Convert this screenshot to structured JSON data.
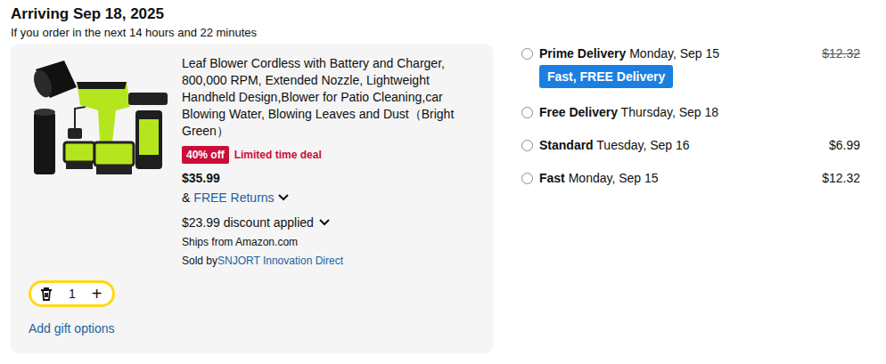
{
  "header": {
    "title": "Arriving Sep 18, 2025",
    "subtitle": "If you order in the next 14 hours and 22 minutes"
  },
  "item": {
    "title": "Leaf Blower Cordless with Battery and Charger, 800,000 RPM, Extended Nozzle, Lightweight Handheld Design,Blower for Patio Cleaning,car Blowing Water, Blowing Leaves and Dust（Bright Green）",
    "badge": "40% off",
    "deal": "Limited time deal",
    "price": "$35.99",
    "returns_prefix": "&",
    "returns": "FREE Returns",
    "discount": "$23.99 discount applied",
    "ships": "Ships from Amazon.com",
    "sold_by_label": "Sold by",
    "seller": "SNJORT Innovation Direct",
    "quantity": "1",
    "plus": "+",
    "gift": "Add gift options"
  },
  "delivery_options": [
    {
      "name": "Prime Delivery",
      "date": "Monday, Sep 15",
      "price": "$12.32",
      "struck": true,
      "tag": "Fast, FREE Delivery",
      "selected": false
    },
    {
      "name": "Free Delivery",
      "date": "Thursday, Sep 18",
      "selected": false,
      "struck": false
    },
    {
      "name": "Standard",
      "date": "Tuesday, Sep 16",
      "price": "$6.99",
      "struck": false,
      "selected": false
    },
    {
      "name": "Fast",
      "date": "Monday, Sep 15",
      "price": "$12.32",
      "struck": false,
      "selected": false
    }
  ]
}
